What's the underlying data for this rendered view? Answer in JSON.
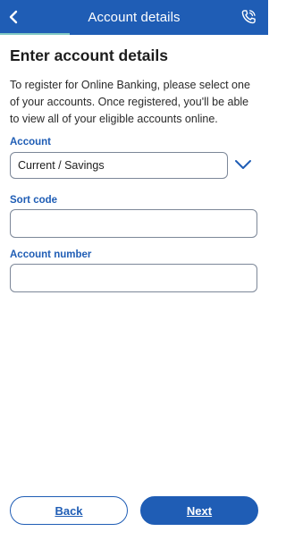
{
  "header": {
    "title": "Account details",
    "back_icon": "chevron-left-icon",
    "call_icon": "phone-icon",
    "progress_fraction": 0.26,
    "background_color": "#1f5db5",
    "progress_color": "#7fc8c4"
  },
  "main": {
    "title": "Enter account details",
    "intro": "To register for Online Banking, please select one of your accounts. Once registered, you'll be able to view all of your eligible accounts online.",
    "account": {
      "label": "Account",
      "selected_value": "Current / Savings",
      "dropdown_icon": "chevron-down-icon"
    },
    "sort_code": {
      "label": "Sort code",
      "value": ""
    },
    "account_number": {
      "label": "Account number",
      "value": ""
    }
  },
  "footer": {
    "back_label": "Back",
    "next_label": "Next"
  },
  "colors": {
    "accent": "#1f5db5",
    "field_border": "#7c8798",
    "text": "#1d1d1d"
  }
}
